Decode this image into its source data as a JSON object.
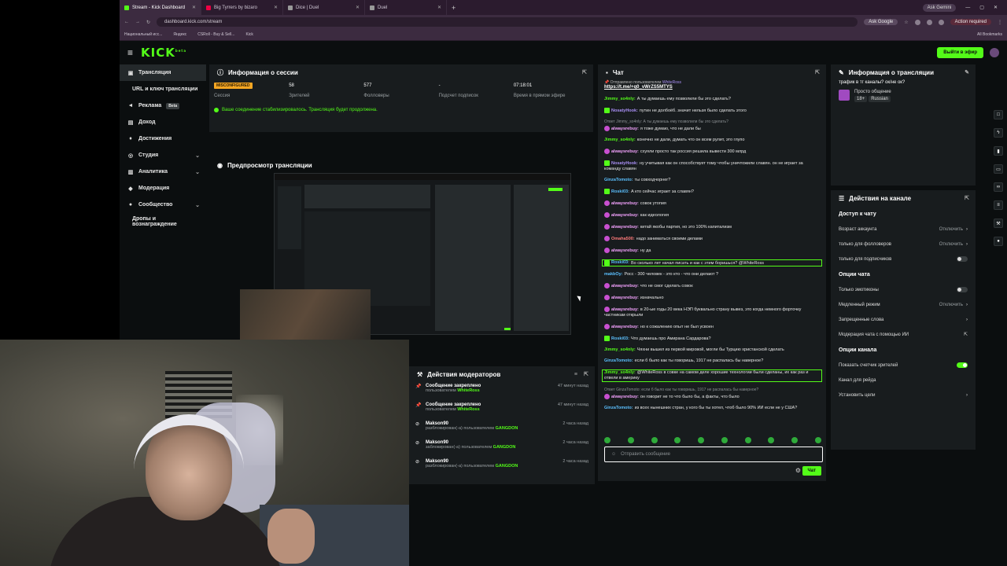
{
  "browser": {
    "tabs": [
      {
        "label": "Stream - Kick Dashboard",
        "active": true
      },
      {
        "label": "Big Tyrrers by bizaro",
        "active": false
      },
      {
        "label": "Dice | Duel",
        "active": false
      },
      {
        "label": "Duel",
        "active": false
      }
    ],
    "ask_gemini": "Ask Gemini",
    "url": "dashboard.kick.com/stream",
    "google_btn": "Ask Google",
    "action_required": "Action required",
    "bookmarks": [
      "Национальный исс...",
      "Яндекс",
      "CSRoll - Buy & Sell...",
      "Kick"
    ],
    "all_bookmarks": "All Bookmarks"
  },
  "header": {
    "logo": "KICK",
    "logo_sup": "beta",
    "go_live": "Выйти в эфир"
  },
  "sidebar": {
    "items": [
      {
        "label": "Трансляция",
        "icon": "broadcast-icon"
      },
      {
        "label": "URL и ключ трансляции",
        "icon": ""
      },
      {
        "label": "Реклама",
        "icon": "megaphone-icon",
        "badge": "Beta"
      },
      {
        "label": "Доход",
        "icon": "wallet-icon"
      },
      {
        "label": "Достижения",
        "icon": "trophy-icon"
      },
      {
        "label": "Студия",
        "icon": "studio-icon"
      },
      {
        "label": "Аналитика",
        "icon": "chart-icon"
      },
      {
        "label": "Модерация",
        "icon": "shield-icon"
      },
      {
        "label": "Сообщество",
        "icon": "community-icon"
      },
      {
        "label": "Дропы и вознаграждение",
        "icon": ""
      }
    ]
  },
  "session": {
    "title": "Информация о сессии",
    "status": "MISCONFIGURED",
    "session_label": "Сессия",
    "viewers": "58",
    "viewers_label": "Зрителей",
    "followers": "577",
    "followers_label": "Фолловеры",
    "subs": "-",
    "subs_label": "Подсчет подписок",
    "uptime": "07:18:01",
    "uptime_label": "Время в прямом эфире",
    "ok_message": "Ваше соединение стабилизировалось. Трансляция будет продолжена."
  },
  "preview": {
    "title": "Предпросмотр трансляции"
  },
  "chat": {
    "title": "Чат",
    "pinned_by": "Отправлено пользователем",
    "pinned_user": "WhiteRoss",
    "pinned_link": "https://t.me/+q0_vWrZS5MTYS",
    "input_placeholder": "Отправить сообщение",
    "send_label": "Чат",
    "messages": [
      {
        "user": "Jimmy_so4nly:",
        "color": "#53fc18",
        "text": "А ты думаешь ему позволили бы это сделать?"
      },
      {
        "user": "NosatyHook:",
        "color": "#a98ff5",
        "text": "путин не долбоёб. значит нельзя было сделать этого",
        "badge": "g"
      },
      {
        "user": "",
        "color": "",
        "text": "Ответ Jimmy_so4nly: А ты думаешь ему позволили бы это сделать?",
        "reply": true
      },
      {
        "user": "alwaysrebuy:",
        "color": "#f5a3ff",
        "text": "я тоже думаю, что не дали бы",
        "badge": "p"
      },
      {
        "user": "Jimmy_so4nly:",
        "color": "#53fc18",
        "text": "конечно не дали, думать что он всем рулит, это глупо"
      },
      {
        "user": "alwaysrebuy:",
        "color": "#f5a3ff",
        "text": "схуяли просто так россия решила вывести 300 млрд",
        "badge": "p"
      },
      {
        "user": "NosatyHook:",
        "color": "#a98ff5",
        "text": "ну учитывая как он способствует тому чтобы уничтожили славян. он не играет за команду славян",
        "badge": "g"
      },
      {
        "user": "GinzaTomoto:",
        "color": "#5bc0ff",
        "text": "ты совходчорнег?"
      },
      {
        "user": "Roski03:",
        "color": "#5bc0ff",
        "text": "А кто сейчас играет за славян?",
        "badge": "g"
      },
      {
        "user": "alwaysrebuy:",
        "color": "#f5a3ff",
        "text": "совок утопия",
        "badge": "p"
      },
      {
        "user": "alwaysrebuy:",
        "color": "#f5a3ff",
        "text": "как идеология",
        "badge": "p"
      },
      {
        "user": "alwaysrebuy:",
        "color": "#f5a3ff",
        "text": "китай якобы партия, но это 100% капитализм",
        "badge": "p"
      },
      {
        "user": "Omaha500:",
        "color": "#ff7a7a",
        "text": "надо заниматься своими делами",
        "badge": "p"
      },
      {
        "user": "alwaysrebuy:",
        "color": "#f5a3ff",
        "text": "ну да",
        "badge": "p"
      },
      {
        "user": "Roski03:",
        "color": "#5bc0ff",
        "text": "Во сколько лет начал писать и как с этим боришься? @WhiteRoss",
        "badge": "g",
        "highlight": true
      },
      {
        "user": "makbOy:",
        "color": "#5bc0ff",
        "text": "Росс - 300 человек - это кто - что они делают ?"
      },
      {
        "user": "alwaysrebuy:",
        "color": "#f5a3ff",
        "text": "что не смог сделать совок",
        "badge": "p"
      },
      {
        "user": "alwaysrebuy:",
        "color": "#f5a3ff",
        "text": "изначально",
        "badge": "p"
      },
      {
        "user": "alwaysrebuy:",
        "color": "#f5a3ff",
        "text": "в 20-ые годы 20 века НЭП буквально страну вывез, это когда немного форточку частникам открыли",
        "badge": "p"
      },
      {
        "user": "alwaysrebuy:",
        "color": "#f5a3ff",
        "text": "но к сожалению опыт не был усвоен",
        "badge": "p"
      },
      {
        "user": "Roski03:",
        "color": "#5bc0ff",
        "text": "Что думаешь про Амирана Сардарова?",
        "badge": "g"
      },
      {
        "user": "Jimmy_so4nly:",
        "color": "#53fc18",
        "text": "Чяхни вышел из первой мировой, могли бы Турцию христанской сделать"
      },
      {
        "user": "GinzaTomoto:",
        "color": "#5bc0ff",
        "text": "если б было как ты говоришь, 1917 не распалась бы наверное?"
      },
      {
        "user": "Jimmy_so4nly:",
        "color": "#53fc18",
        "text": "@WhiteRoss в совке на самом деле хорошие технологии были сделаны, их как раз и отвели в америку",
        "highlight": true
      },
      {
        "user": "",
        "color": "",
        "text": "Ответ GinzaTomoto: если б было как ты говоришь, 1917 не распалась бы наверное?",
        "reply": true
      },
      {
        "user": "alwaysrebuy:",
        "color": "#f5a3ff",
        "text": "он говорит не то что было бы, а факты, что было",
        "badge": "p"
      },
      {
        "user": "GinzaTomoto:",
        "color": "#5bc0ff",
        "text": "из всех нынешних стран, у кого бы ты хотел, чтоб было 90% ИИ если не у США?"
      }
    ]
  },
  "stream_info": {
    "title": "Информация о трансляции",
    "stream_title": "трафик в тг каналы? ок/не ок?",
    "category": "Просто общение",
    "tag_age": "18+",
    "tag_lang": "Russian"
  },
  "channel_actions": {
    "title": "Действия на канале",
    "sections": [
      {
        "heading": "Доступ к чату",
        "rows": [
          {
            "label": "Возраст аккаунта",
            "value": "Отключить",
            "kind": "chevron"
          },
          {
            "label": "только для фолловеров",
            "value": "Отключить",
            "kind": "chevron"
          },
          {
            "label": "только для подписчиков",
            "value": "",
            "kind": "toggle-off"
          }
        ]
      },
      {
        "heading": "Опции чата",
        "rows": [
          {
            "label": "Только эмотиконы",
            "value": "",
            "kind": "toggle-off"
          },
          {
            "label": "Медленный режим",
            "value": "Отключить",
            "kind": "chevron"
          },
          {
            "label": "Запрещенные слова",
            "value": "",
            "kind": "chevron"
          },
          {
            "label": "Модерация чата с помощью ИИ",
            "value": "",
            "kind": "external"
          }
        ]
      },
      {
        "heading": "Опции канала",
        "rows": [
          {
            "label": "Показать счетчик зрителей",
            "value": "",
            "kind": "toggle-on"
          },
          {
            "label": "Канал для рейда",
            "value": "",
            "kind": "none"
          },
          {
            "label": "Установить цели",
            "value": "",
            "kind": "chevron"
          }
        ]
      }
    ]
  },
  "mod_actions": {
    "title": "Действия модераторов",
    "items": [
      {
        "title": "Сообщение закреплено",
        "sub": "пользователем",
        "who": "WhiteRoss",
        "time": "47 минут назад",
        "icon": "pin-icon"
      },
      {
        "title": "Сообщение закреплено",
        "sub": "пользователем",
        "who": "WhiteRoss",
        "time": "47 минут назад",
        "icon": "pin-icon"
      },
      {
        "title": "Makson90",
        "sub": "разблокирован(-а) пользователем",
        "who": "GANGDON",
        "time": "2 часа назад",
        "icon": "unban-icon"
      },
      {
        "title": "Makson90",
        "sub": "заблокирован(-а) пользователем",
        "who": "GANGDON",
        "time": "2 часа назад",
        "icon": "ban-icon"
      },
      {
        "title": "Makson90",
        "sub": "разблокирован(-а) пользователем",
        "who": "GANGDON",
        "time": "2 часа назад",
        "icon": "unban-icon"
      }
    ]
  }
}
